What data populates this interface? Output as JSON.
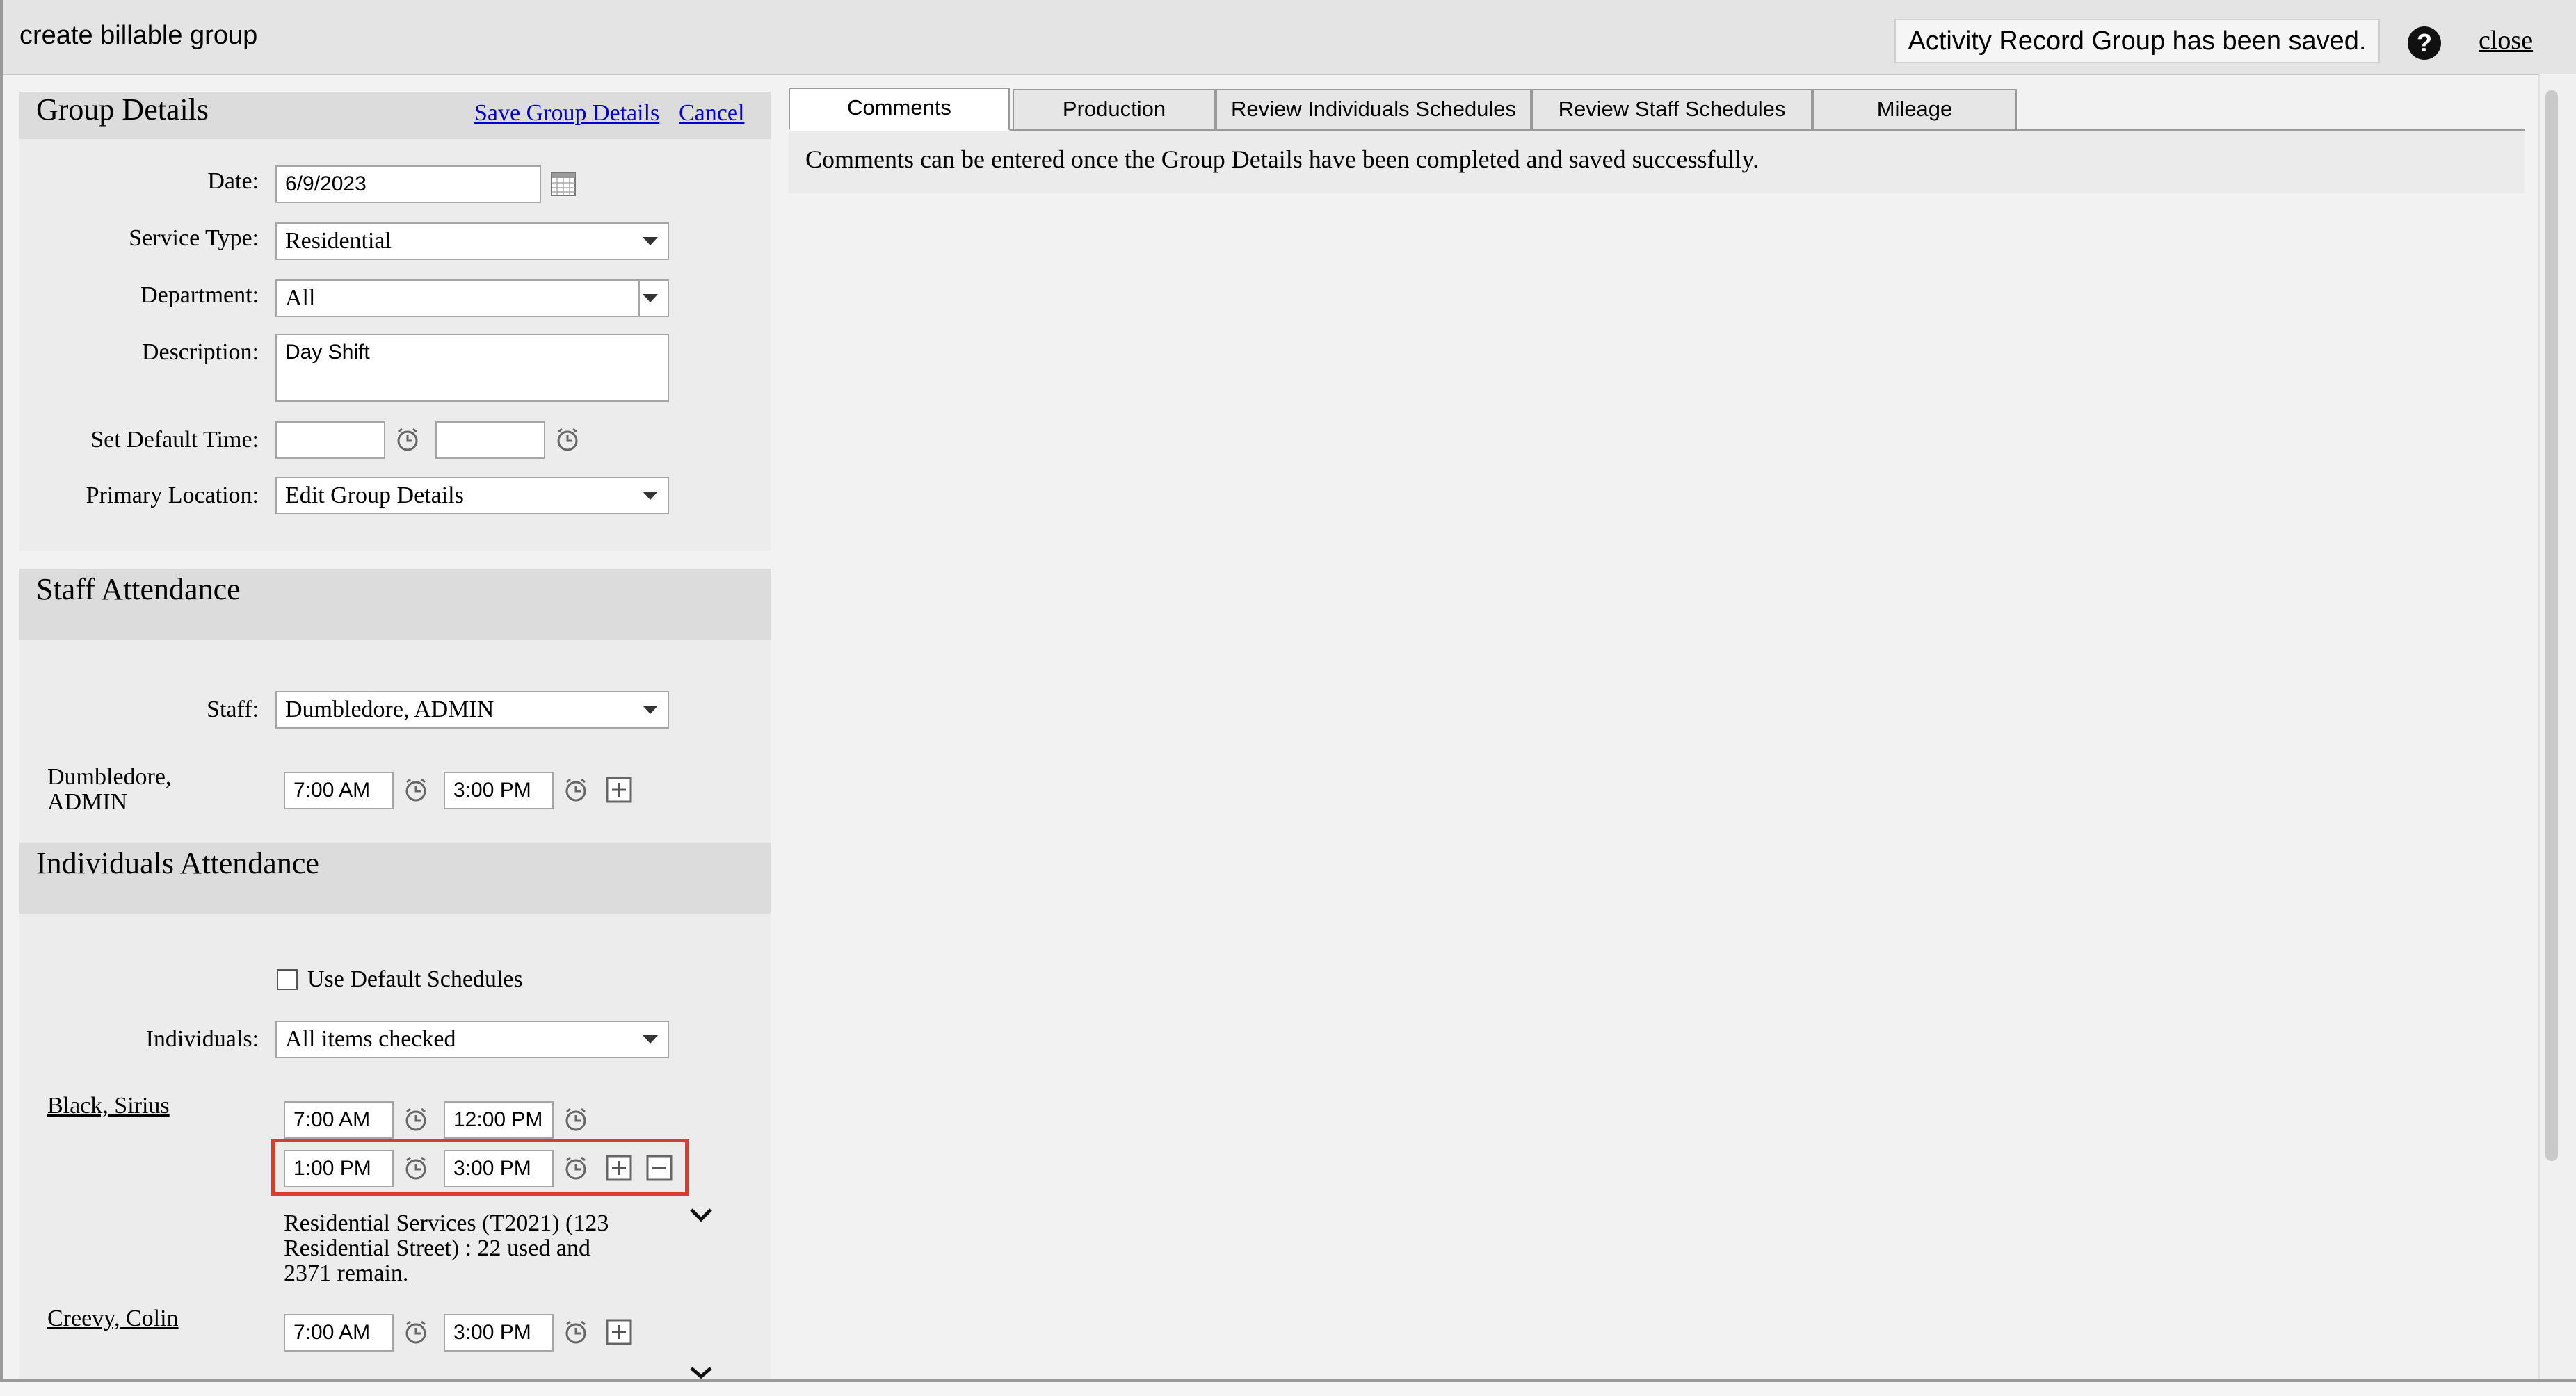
{
  "window": {
    "title": "create billable group",
    "toast": "Activity Record Group has been saved.",
    "help_label": "?",
    "close_label": "close"
  },
  "group_details": {
    "title": "Group Details",
    "save_label": "Save Group Details",
    "cancel_label": "Cancel",
    "date_label": "Date:",
    "date_value": "6/9/2023",
    "service_type_label": "Service Type:",
    "service_type_value": "Residential",
    "department_label": "Department:",
    "department_value": "All",
    "description_label": "Description:",
    "description_value": "Day Shift",
    "default_time_label": "Set Default Time:",
    "default_time_start": "",
    "default_time_end": "",
    "primary_location_label": "Primary Location:",
    "primary_location_value": "Edit Group Details"
  },
  "staff_attendance": {
    "title": "Staff Attendance",
    "staff_label": "Staff:",
    "staff_value": "Dumbledore, ADMIN",
    "rows": [
      {
        "name_line1": "Dumbledore,",
        "name_line2": "ADMIN",
        "start": "7:00 AM",
        "end": "3:00 PM"
      }
    ]
  },
  "individuals_attendance": {
    "title": "Individuals Attendance",
    "use_default_label": "Use Default Schedules",
    "use_default_checked": false,
    "individuals_label": "Individuals:",
    "individuals_value": "All items checked",
    "people": [
      {
        "name": "Black, Sirius",
        "schedules": [
          {
            "start": "7:00 AM",
            "end": "12:00 PM"
          },
          {
            "start": "1:00 PM",
            "end": "3:00 PM"
          }
        ],
        "authorization_line1": "Residential Services (T2021) (123",
        "authorization_line2": "Residential Street) : 22 used and",
        "authorization_line3": "2371 remain."
      },
      {
        "name": "Creevy, Colin",
        "schedules": [
          {
            "start": "7:00 AM",
            "end": "3:00 PM"
          }
        ]
      }
    ]
  },
  "tabs": [
    {
      "label": "Comments",
      "active": true
    },
    {
      "label": "Production",
      "active": false
    },
    {
      "label": "Review Individuals Schedules",
      "active": false
    },
    {
      "label": "Review Staff Schedules",
      "active": false
    },
    {
      "label": "Mileage",
      "active": false
    }
  ],
  "comments": {
    "message": "Comments can be entered once the Group Details have been completed and saved successfully."
  },
  "colors": {
    "highlight_border": "#d93c28",
    "link_blue": "#0000cc",
    "panel_bg": "#ececec",
    "section_header_bg": "#dcdcdc"
  },
  "icons": [
    "calendar-icon",
    "clock-icon",
    "plus-square-icon",
    "minus-square-icon",
    "chevron-down-icon",
    "help-icon"
  ]
}
